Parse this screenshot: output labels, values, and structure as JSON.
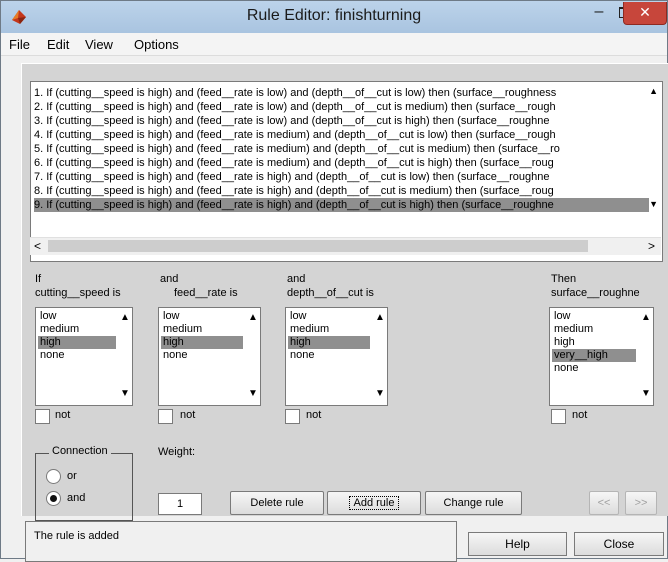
{
  "window": {
    "title": "Rule Editor: finishturning"
  },
  "menu": [
    "File",
    "Edit",
    "View",
    "Options"
  ],
  "rules": [
    "1. If (cutting__speed is high) and (feed__rate is low) and (depth__of__cut is low) then (surface__roughness",
    "2. If (cutting__speed is high) and (feed__rate is low) and (depth__of__cut is medium) then (surface__rough",
    "3. If (cutting__speed is high) and (feed__rate is low) and (depth__of__cut is high) then (surface__roughne",
    "4. If (cutting__speed is high) and (feed__rate is medium) and (depth__of__cut is low) then (surface__rough",
    "5. If (cutting__speed is high) and (feed__rate is medium) and (depth__of__cut is medium) then (surface__ro",
    "6. If (cutting__speed is high) and (feed__rate is medium) and (depth__of__cut is high) then (surface__roug",
    "7. If (cutting__speed is high) and (feed__rate is high) and (depth__of__cut is low) then (surface__roughne",
    "8. If (cutting__speed is high) and (feed__rate is high) and (depth__of__cut is medium) then (surface__roug",
    "9. If (cutting__speed is high) and (feed__rate is high) and (depth__of__cut is high) then (surface__roughne"
  ],
  "selected_rule_index": 8,
  "columns": [
    {
      "connector": "If",
      "variable": "cutting__speed is",
      "options": [
        "low",
        "medium",
        "high",
        "none"
      ],
      "selected": "high",
      "not_label": "not"
    },
    {
      "connector": "and",
      "variable": "feed__rate is",
      "options": [
        "low",
        "medium",
        "high",
        "none"
      ],
      "selected": "high",
      "not_label": "not"
    },
    {
      "connector": "and",
      "variable": "depth__of__cut is",
      "options": [
        "low",
        "medium",
        "high",
        "none"
      ],
      "selected": "high",
      "not_label": "not"
    },
    {
      "connector": "Then",
      "variable": "surface__roughne",
      "options": [
        "low",
        "medium",
        "high",
        "very__high",
        "none"
      ],
      "selected": "very__high",
      "not_label": "not"
    }
  ],
  "connection": {
    "title": "Connection",
    "options": [
      "or",
      "and"
    ],
    "selected": "and"
  },
  "weight": {
    "label": "Weight:",
    "value": "1"
  },
  "buttons": {
    "delete_rule": "Delete rule",
    "add_rule": "Add rule",
    "change_rule": "Change rule",
    "prev": "<<",
    "next": ">>",
    "help": "Help",
    "close": "Close"
  },
  "status": "The rule is added",
  "colors": {
    "selection": "#8f8f8f",
    "panel": "#d4d4d4",
    "titlebar": "#a9c4e0",
    "close": "#c7463b"
  }
}
